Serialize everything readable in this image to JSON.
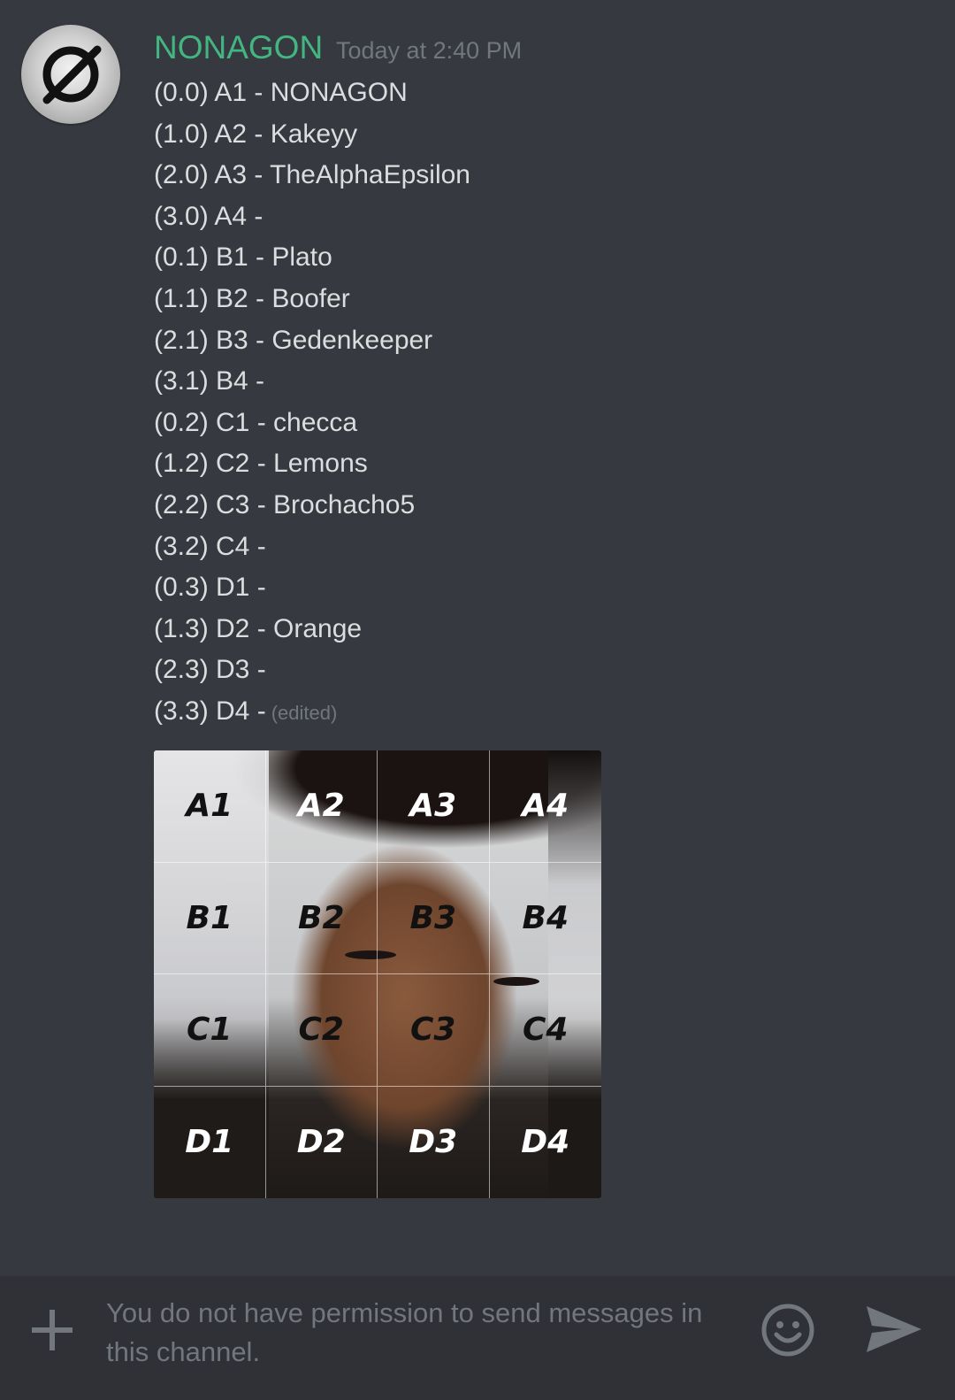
{
  "message": {
    "author": "NONAGON",
    "timestamp": "Today at 2:40 PM",
    "lines": [
      "(0.0) A1 - NONAGON",
      "(1.0) A2 - Kakeyy",
      "(2.0) A3 - TheAlphaEpsilon",
      "(3.0) A4 -",
      "(0.1) B1 - Plato",
      "(1.1) B2 - Boofer",
      "(2.1) B3 - Gedenkeeper",
      "(3.1) B4 -",
      "(0.2) C1 - checca",
      "(1.2) C2 - Lemons",
      "(2.2) C3 - Brochacho5",
      "(3.2) C4 -",
      "(0.3) D1 -",
      "(1.3) D2 - Orange",
      "(2.3) D3 -",
      "(3.3) D4 -"
    ],
    "edited_label": "(edited)",
    "avatar_icon": "empty-set-icon"
  },
  "attachment": {
    "cells": [
      "A1",
      "A2",
      "A3",
      "A4",
      "B1",
      "B2",
      "B3",
      "B4",
      "C1",
      "C2",
      "C3",
      "C4",
      "D1",
      "D2",
      "D3",
      "D4"
    ]
  },
  "composer": {
    "placeholder": "You do not have permission to send messages in this channel.",
    "icons": [
      "plus-icon",
      "emoji-icon",
      "send-icon"
    ]
  },
  "colors": {
    "background": "#36393f",
    "author": "#43b581",
    "muted": "#72767d",
    "text": "#dcddde",
    "composer": "#2f3136"
  }
}
